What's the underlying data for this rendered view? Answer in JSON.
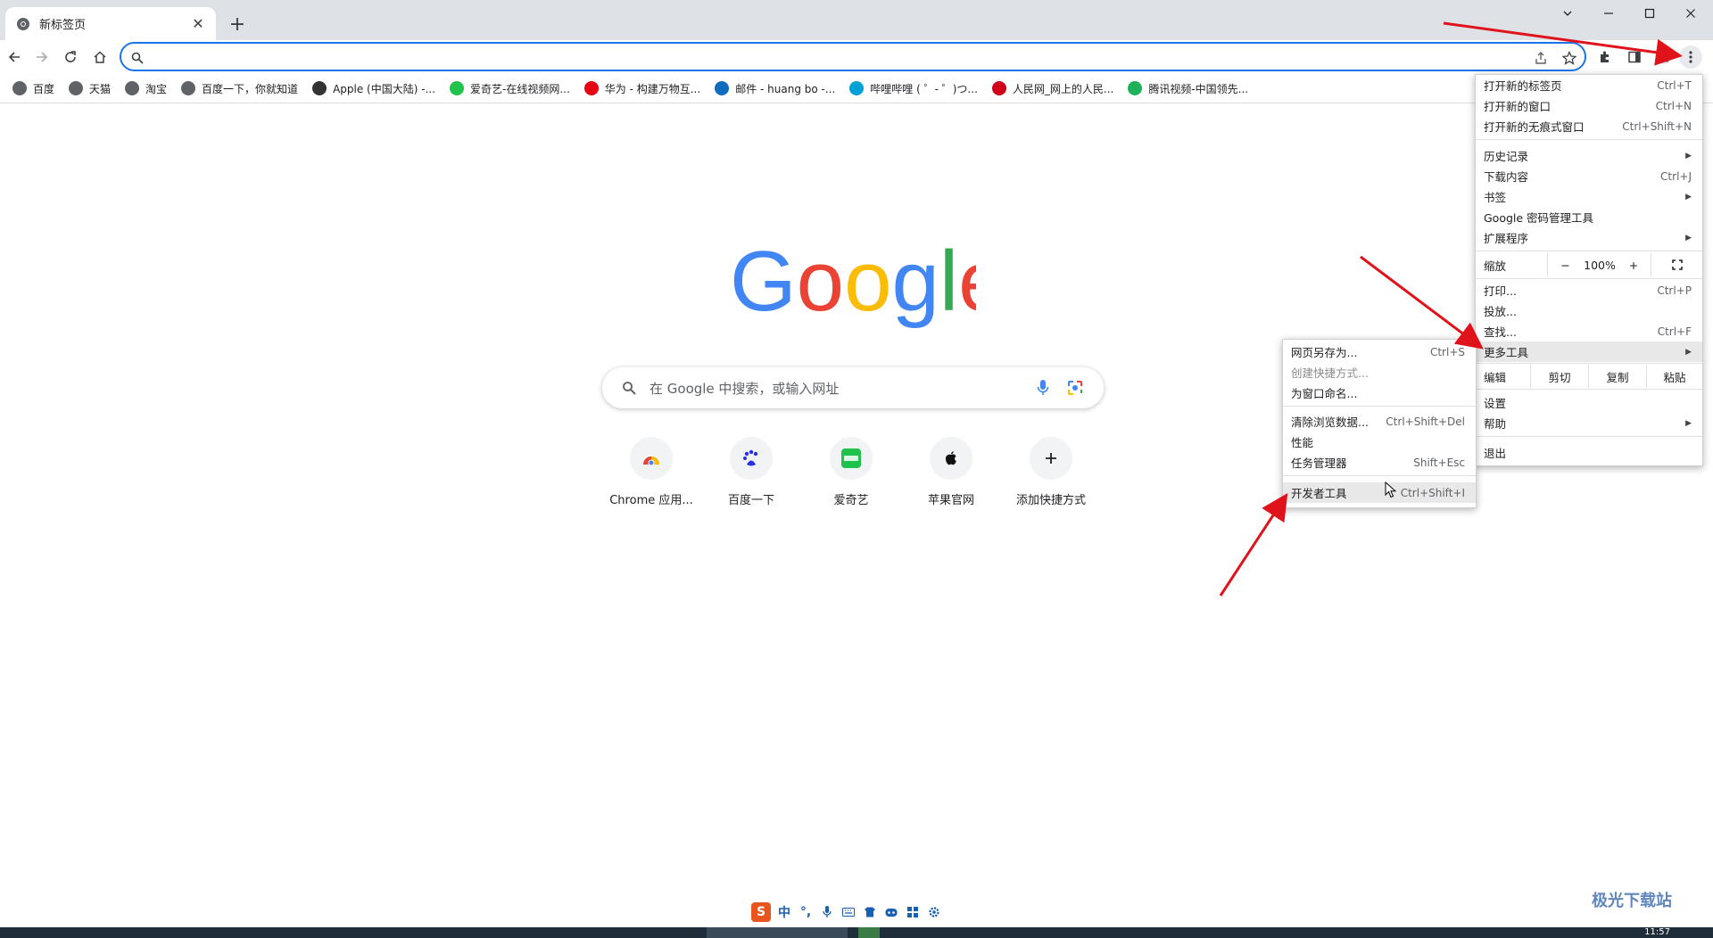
{
  "tab": {
    "title": "新标签页",
    "close": "✕",
    "new_tab": "+"
  },
  "bookmarks": [
    {
      "label": "百度",
      "color": "#5f6368"
    },
    {
      "label": "天猫",
      "color": "#5f6368"
    },
    {
      "label": "淘宝",
      "color": "#5f6368"
    },
    {
      "label": "百度一下，你就知道",
      "color": "#5f6368"
    },
    {
      "label": "Apple (中国大陆) -...",
      "color": "#333333"
    },
    {
      "label": "爱奇艺-在线视频网...",
      "color": "#1fc24b"
    },
    {
      "label": "华为 - 构建万物互...",
      "color": "#e60012"
    },
    {
      "label": "邮件 - huang bo -...",
      "color": "#0f6cbd"
    },
    {
      "label": "哔哩哔哩 ( ゜- ゜)つ...",
      "color": "#00a1d6"
    },
    {
      "label": "人民网_网上的人民...",
      "color": "#d0021b"
    },
    {
      "label": "腾讯视频-中国领先...",
      "color": "#20b15a"
    }
  ],
  "search": {
    "placeholder": "在 Google 中搜索，或输入网址"
  },
  "shortcuts": [
    {
      "label": "Chrome 应用..."
    },
    {
      "label": "百度一下"
    },
    {
      "label": "爱奇艺"
    },
    {
      "label": "苹果官网"
    },
    {
      "label": "添加快捷方式"
    }
  ],
  "main_menu": {
    "new_tab": {
      "label": "打开新的标签页",
      "shortcut": "Ctrl+T"
    },
    "new_window": {
      "label": "打开新的窗口",
      "shortcut": "Ctrl+N"
    },
    "incognito": {
      "label": "打开新的无痕式窗口",
      "shortcut": "Ctrl+Shift+N"
    },
    "history": {
      "label": "历史记录"
    },
    "downloads": {
      "label": "下载内容",
      "shortcut": "Ctrl+J"
    },
    "bookmarks": {
      "label": "书签"
    },
    "passwords": {
      "label": "Google 密码管理工具"
    },
    "extensions": {
      "label": "扩展程序"
    },
    "zoom": {
      "label": "缩放",
      "minus": "−",
      "value": "100%",
      "plus": "+"
    },
    "print": {
      "label": "打印...",
      "shortcut": "Ctrl+P"
    },
    "cast": {
      "label": "投放..."
    },
    "find": {
      "label": "查找...",
      "shortcut": "Ctrl+F"
    },
    "more_tools": {
      "label": "更多工具"
    },
    "edit": {
      "label": "编辑",
      "cut": "剪切",
      "copy": "复制",
      "paste": "粘贴"
    },
    "settings": {
      "label": "设置"
    },
    "help": {
      "label": "帮助"
    },
    "exit": {
      "label": "退出"
    }
  },
  "submenu": {
    "save_page": {
      "label": "网页另存为...",
      "shortcut": "Ctrl+S"
    },
    "create_shortcut": {
      "label": "创建快捷方式..."
    },
    "name_window": {
      "label": "为窗口命名..."
    },
    "clear_data": {
      "label": "清除浏览数据...",
      "shortcut": "Ctrl+Shift+Del"
    },
    "performance": {
      "label": "性能"
    },
    "task_manager": {
      "label": "任务管理器",
      "shortcut": "Shift+Esc"
    },
    "devtools": {
      "label": "开发者工具",
      "shortcut": "Ctrl+Shift+I"
    }
  },
  "ime": {
    "mode": "中",
    "punct": "°,"
  },
  "watermark": "极光下载站",
  "clock": "11:57",
  "colors": {
    "accent": "#1a73e8",
    "arrow": "#e0131b"
  }
}
